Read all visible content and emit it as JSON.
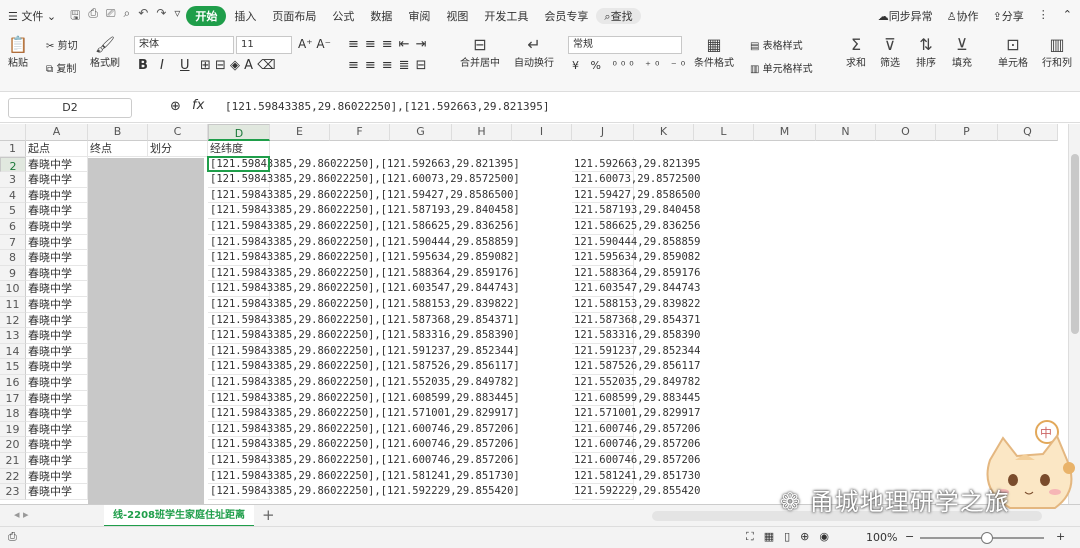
{
  "menu": {
    "file": "文件",
    "tabs": [
      "开始",
      "插入",
      "页面布局",
      "公式",
      "数据",
      "审阅",
      "视图",
      "开发工具",
      "会员专享"
    ],
    "search": "查找",
    "sync": "同步异常",
    "collab": "协作",
    "share": "分享"
  },
  "ribbon": {
    "paste": "粘贴",
    "cut": "剪切",
    "copy": "复制",
    "format_painter": "格式刷",
    "font": "宋体",
    "size": "11",
    "merge": "合并居中",
    "wrap": "自动换行",
    "numfmt": "常规",
    "cond": "条件格式",
    "table_style": "表格样式",
    "cell_style": "单元格样式",
    "sum": "求和",
    "filter": "筛选",
    "sort": "排序",
    "fill": "填充",
    "cell": "单元格",
    "rowcol": "行和列"
  },
  "formula_bar": {
    "name": "D2",
    "content": "[121.59843385,29.86022250],[121.592663,29.821395]"
  },
  "columns": [
    "A",
    "B",
    "C",
    "D",
    "E",
    "F",
    "G",
    "H",
    "I",
    "J",
    "K",
    "L",
    "M",
    "N",
    "O",
    "P",
    "Q"
  ],
  "headers": {
    "a": "起点",
    "b": "终点",
    "c": "划分",
    "d": "经纬度"
  },
  "rows": [
    {
      "n": "2",
      "a": "春晓中学",
      "d": "[121.59843385,29.86022250],[121.592663,29.821395]",
      "j": "121.592663,29.821395"
    },
    {
      "n": "3",
      "a": "春晓中学",
      "d": "[121.59843385,29.86022250],[121.60073,29.8572500]",
      "j": "121.60073,29.8572500"
    },
    {
      "n": "4",
      "a": "春晓中学",
      "d": "[121.59843385,29.86022250],[121.59427,29.8586500]",
      "j": "121.59427,29.8586500"
    },
    {
      "n": "5",
      "a": "春晓中学",
      "d": "[121.59843385,29.86022250],[121.587193,29.840458]",
      "j": "121.587193,29.840458"
    },
    {
      "n": "6",
      "a": "春晓中学",
      "d": "[121.59843385,29.86022250],[121.586625,29.836256]",
      "j": "121.586625,29.836256"
    },
    {
      "n": "7",
      "a": "春晓中学",
      "d": "[121.59843385,29.86022250],[121.590444,29.858859]",
      "j": "121.590444,29.858859"
    },
    {
      "n": "8",
      "a": "春晓中学",
      "d": "[121.59843385,29.86022250],[121.595634,29.859082]",
      "j": "121.595634,29.859082"
    },
    {
      "n": "9",
      "a": "春晓中学",
      "d": "[121.59843385,29.86022250],[121.588364,29.859176]",
      "j": "121.588364,29.859176"
    },
    {
      "n": "10",
      "a": "春晓中学",
      "d": "[121.59843385,29.86022250],[121.603547,29.844743]",
      "j": "121.603547,29.844743"
    },
    {
      "n": "11",
      "a": "春晓中学",
      "d": "[121.59843385,29.86022250],[121.588153,29.839822]",
      "j": "121.588153,29.839822"
    },
    {
      "n": "12",
      "a": "春晓中学",
      "d": "[121.59843385,29.86022250],[121.587368,29.854371]",
      "j": "121.587368,29.854371"
    },
    {
      "n": "13",
      "a": "春晓中学",
      "d": "[121.59843385,29.86022250],[121.583316,29.858390]",
      "j": "121.583316,29.858390"
    },
    {
      "n": "14",
      "a": "春晓中学",
      "d": "[121.59843385,29.86022250],[121.591237,29.852344]",
      "j": "121.591237,29.852344"
    },
    {
      "n": "15",
      "a": "春晓中学",
      "d": "[121.59843385,29.86022250],[121.587526,29.856117]",
      "j": "121.587526,29.856117"
    },
    {
      "n": "16",
      "a": "春晓中学",
      "d": "[121.59843385,29.86022250],[121.552035,29.849782]",
      "j": "121.552035,29.849782"
    },
    {
      "n": "17",
      "a": "春晓中学",
      "d": "[121.59843385,29.86022250],[121.608599,29.883445]",
      "j": "121.608599,29.883445"
    },
    {
      "n": "18",
      "a": "春晓中学",
      "d": "[121.59843385,29.86022250],[121.571001,29.829917]",
      "j": "121.571001,29.829917"
    },
    {
      "n": "19",
      "a": "春晓中学",
      "d": "[121.59843385,29.86022250],[121.600746,29.857206]",
      "j": "121.600746,29.857206"
    },
    {
      "n": "20",
      "a": "春晓中学",
      "d": "[121.59843385,29.86022250],[121.600746,29.857206]",
      "j": "121.600746,29.857206"
    },
    {
      "n": "21",
      "a": "春晓中学",
      "d": "[121.59843385,29.86022250],[121.600746,29.857206]",
      "j": "121.600746,29.857206"
    },
    {
      "n": "22",
      "a": "春晓中学",
      "d": "[121.59843385,29.86022250],[121.581241,29.851730]",
      "j": "121.581241,29.851730"
    },
    {
      "n": "23",
      "a": "春晓中学",
      "d": "[121.59843385,29.86022250],[121.592229,29.855420]",
      "j": "121.592229,29.855420"
    }
  ],
  "sheet_tab": "线-2208班学生家庭住址距离",
  "status": {
    "zoom": "100%"
  },
  "watermark": "甬城地理研学之旅",
  "colors": {
    "accent": "#1f9e4a"
  }
}
